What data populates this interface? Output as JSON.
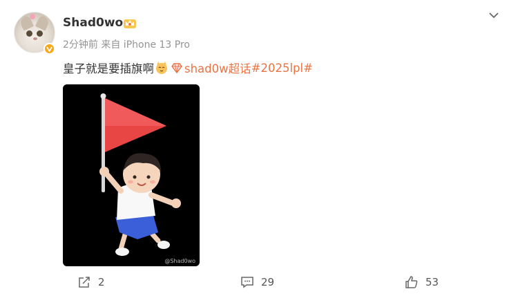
{
  "post": {
    "author": {
      "name": "Shad0wo",
      "avatar_icon": "cat-avatar",
      "badge_icon": "verified-badge-icon",
      "crown_icon": "crown-icon"
    },
    "meta": "2分钟前 来自 iPhone 13 Pro",
    "text": "皇子就是要插旗啊",
    "emoji_icons": [
      "cat-emoji-icon",
      "diamond-emoji-icon"
    ],
    "topic_link": "shad0w超话",
    "hashtag": "#2025lpl#",
    "image": {
      "description_icon": "boy-with-red-flag-image",
      "watermark": "@Shad0wo"
    }
  },
  "actions": {
    "share_count": "2",
    "comment_count": "29",
    "like_count": "53"
  },
  "colors": {
    "accent_link": "#eb7340",
    "verify_badge": "#f7a614",
    "meta_gray": "#939393"
  }
}
